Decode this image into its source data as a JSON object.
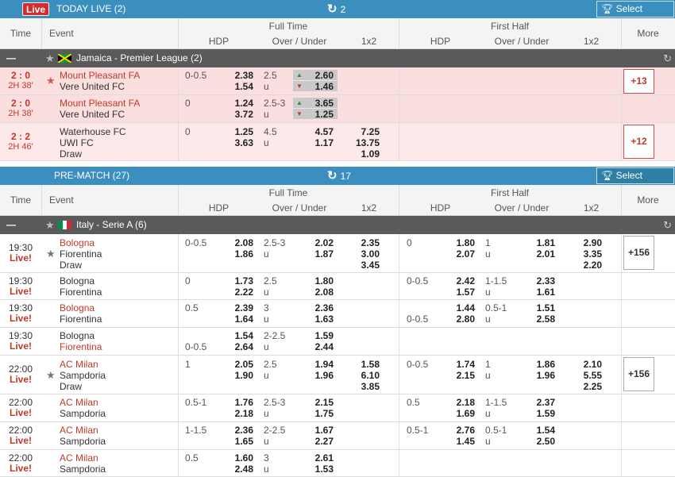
{
  "live": {
    "badge": "Live",
    "title": "TODAY LIVE (2)",
    "refresh_count": "2",
    "select_league": "Select League"
  },
  "prematch": {
    "title": "PRE-MATCH (27)",
    "refresh_count": "17",
    "select_league": "Select League"
  },
  "columns": {
    "time": "Time",
    "event": "Event",
    "full_time": "Full Time",
    "first_half": "First Half",
    "more": "More",
    "hdp": "HDP",
    "over_under": "Over / Under",
    "x12": "1x2"
  },
  "leagues": {
    "jamaica": {
      "name": "Jamaica - Premier League (2)",
      "flag": "jamaica-flag"
    },
    "italy": {
      "name": "Italy - Serie A (6)",
      "flag": "italy-flag"
    }
  },
  "live_rows": [
    {
      "score": "2 : 0",
      "period": "2H 38'",
      "home": "Mount Pleasant FA",
      "away": "Vere United FC",
      "hdp": "0-0.5",
      "hdp_h": "2.38",
      "hdp_a": "1.54",
      "ou_line": "2.5",
      "ou_u": "u",
      "ou_o": "2.60",
      "ou_un": "1.46",
      "more": "+13"
    },
    {
      "score": "2 : 0",
      "period": "2H 38'",
      "home": "Mount Pleasant FA",
      "away": "Vere United FC",
      "hdp": "0",
      "hdp_h": "1.24",
      "hdp_a": "3.72",
      "ou_line": "2.5-3",
      "ou_u": "u",
      "ou_o": "3.65",
      "ou_un": "1.25"
    },
    {
      "score": "2 : 2",
      "period": "2H 46'",
      "home": "Waterhouse FC",
      "away": "UWI FC",
      "draw": "Draw",
      "hdp": "0",
      "hdp_h": "1.25",
      "hdp_a": "3.63",
      "ou_line": "4.5",
      "ou_u": "u",
      "ou_o": "4.57",
      "ou_un": "1.17",
      "x1": "7.25",
      "x2": "13.75",
      "xd": "1.09",
      "more": "+12"
    }
  ],
  "pre_rows": [
    {
      "time": "19:30",
      "live": "Live!",
      "home": "Bologna",
      "away": "Fiorentina",
      "draw": "Draw",
      "ft_hdp": "0-0.5",
      "ft_h": "2.08",
      "ft_a": "1.86",
      "ft_line": "2.5-3",
      "ft_u": "u",
      "ft_o": "2.02",
      "ft_un": "1.87",
      "ft_x1": "2.35",
      "ft_x2": "3.00",
      "ft_xd": "3.45",
      "fh_hdp": "0",
      "fh_h": "1.80",
      "fh_a": "2.07",
      "fh_line": "1",
      "fh_u": "u",
      "fh_o": "1.81",
      "fh_un": "2.01",
      "fh_x1": "2.90",
      "fh_x2": "3.35",
      "fh_xd": "2.20",
      "more": "+156"
    },
    {
      "time": "19:30",
      "live": "Live!",
      "home": "Bologna",
      "away": "Fiorentina",
      "ft_hdp": "0",
      "ft_h": "1.73",
      "ft_a": "2.22",
      "ft_line": "2.5",
      "ft_u": "u",
      "ft_o": "1.80",
      "ft_un": "2.08",
      "fh_hdp": "0-0.5",
      "fh_h": "2.42",
      "fh_a": "1.57",
      "fh_line": "1-1.5",
      "fh_u": "u",
      "fh_o": "2.33",
      "fh_un": "1.61"
    },
    {
      "time": "19:30",
      "live": "Live!",
      "home": "Bologna",
      "away": "Fiorentina",
      "ft_hdp": "0.5",
      "ft_h": "2.39",
      "ft_a": "1.64",
      "ft_line": "3",
      "ft_u": "u",
      "ft_o": "2.36",
      "ft_un": "1.63",
      "fh_hdp2": "0-0.5",
      "fh_h": "1.44",
      "fh_a": "2.80",
      "fh_line": "0.5-1",
      "fh_u": "u",
      "fh_o": "1.51",
      "fh_un": "2.58"
    },
    {
      "time": "19:30",
      "live": "Live!",
      "home": "Bologna",
      "away": "Fiorentina",
      "ft_hdp2": "0-0.5",
      "ft_h": "1.54",
      "ft_a": "2.64",
      "ft_line": "2-2.5",
      "ft_u": "u",
      "ft_o": "1.59",
      "ft_un": "2.44"
    },
    {
      "time": "22:00",
      "live": "Live!",
      "home": "AC Milan",
      "away": "Sampdoria",
      "draw": "Draw",
      "ft_hdp": "1",
      "ft_h": "2.05",
      "ft_a": "1.90",
      "ft_line": "2.5",
      "ft_u": "u",
      "ft_o": "1.94",
      "ft_un": "1.96",
      "ft_x1": "1.58",
      "ft_x2": "6.10",
      "ft_xd": "3.85",
      "fh_hdp": "0-0.5",
      "fh_h": "1.74",
      "fh_a": "2.15",
      "fh_line": "1",
      "fh_u": "u",
      "fh_o": "1.86",
      "fh_un": "1.96",
      "fh_x1": "2.10",
      "fh_x2": "5.55",
      "fh_xd": "2.25",
      "more": "+156"
    },
    {
      "time": "22:00",
      "live": "Live!",
      "home": "AC Milan",
      "away": "Sampdoria",
      "ft_hdp": "0.5-1",
      "ft_h": "1.76",
      "ft_a": "2.18",
      "ft_line": "2.5-3",
      "ft_u": "u",
      "ft_o": "2.15",
      "ft_un": "1.75",
      "fh_hdp": "0.5",
      "fh_h": "2.18",
      "fh_a": "1.69",
      "fh_line": "1-1.5",
      "fh_u": "u",
      "fh_o": "2.37",
      "fh_un": "1.59"
    },
    {
      "time": "22:00",
      "live": "Live!",
      "home": "AC Milan",
      "away": "Sampdoria",
      "ft_hdp": "1-1.5",
      "ft_h": "2.36",
      "ft_a": "1.65",
      "ft_line": "2-2.5",
      "ft_u": "u",
      "ft_o": "1.67",
      "ft_un": "2.27",
      "fh_hdp": "0.5-1",
      "fh_h": "2.76",
      "fh_a": "1.45",
      "fh_line": "0.5-1",
      "fh_u": "u",
      "fh_o": "1.54",
      "fh_un": "2.50"
    },
    {
      "time": "22:00",
      "live": "Live!",
      "home": "AC Milan",
      "away": "Sampdoria",
      "ft_hdp": "0.5",
      "ft_h": "1.60",
      "ft_a": "2.48",
      "ft_line": "3",
      "ft_u": "u",
      "ft_o": "2.61",
      "ft_un": "1.53"
    }
  ],
  "colors": {
    "header": "#3a8fbf",
    "live_red": "#c0392b",
    "league_bar": "#5a5a5a",
    "live_row_bg": "#fbdede"
  }
}
